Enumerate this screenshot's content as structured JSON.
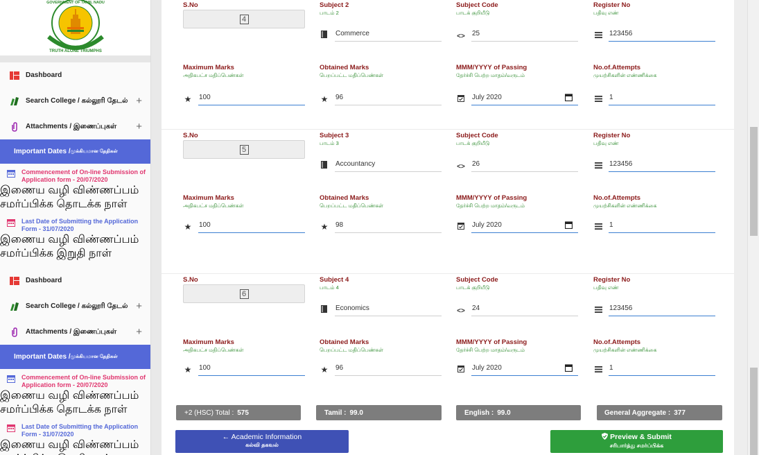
{
  "logo": {
    "alt_text_lines": [
      "GOVERNMENT OF TAMIL NADU",
      "TRUTH ALONE TRIUMPHS"
    ]
  },
  "sidebar": {
    "blocks": [
      {
        "dashboard": "Dashboard",
        "search": {
          "en": "Search College /",
          "ta": "கல்லூரி தேடல்"
        },
        "attachments": {
          "en": "Attachments /",
          "ta": "இணைப்புகள்"
        },
        "important": {
          "en": "Important Dates /",
          "ta": "முக்கியமான தேதிகள்"
        },
        "dates": [
          {
            "text": "Commencement of On-line Submission of Application form - 20/07/2020",
            "sub": "இணைய வழி விண்ணப்பம் சமர்ப்பிக்க தொடக்க நாள்",
            "color": "#e0366f"
          },
          {
            "text": "Last Date of Submitting the Application Form - 31/07/2020",
            "sub": "இணைய வழி விண்ணப்பம் சமர்ப்பிக்க இறுதி நாள்",
            "color": "#5468d8"
          }
        ]
      },
      {
        "dashboard": "Dashboard",
        "search": {
          "en": "Search College /",
          "ta": "கல்லூரி தேடல்"
        },
        "attachments": {
          "en": "Attachments /",
          "ta": "இணைப்புகள்"
        },
        "important": {
          "en": "Important Dates /",
          "ta": "முக்கியமான தேதிகள்"
        },
        "dates": [
          {
            "text": "Commencement of On-line Submission of Application form - 20/07/2020",
            "sub": "இணைய வழி விண்ணப்பம் சமர்ப்பிக்க தொடக்க நாள்",
            "color": "#e0366f"
          },
          {
            "text": "Last Date of Submitting the Application Form - 31/07/2020",
            "sub": "இணைய வழி விண்ணப்பம் சமர்ப்பிக்க இறுதி நாள்",
            "color": "#5468d8"
          }
        ]
      }
    ],
    "plus": "+"
  },
  "labels": {
    "sno": "S.No",
    "subject_code_en": "Subject Code",
    "subject_code_ta": "பாடக் குறியீடு",
    "register_en": "Register No",
    "register_ta": "பதிவு எண்",
    "max_en": "Maximum Marks",
    "max_ta": "அதிகபட்ச மதிப்பெண்கள்",
    "obt_en": "Obtained Marks",
    "obt_ta": "பெறப்பட்ட மதிப்பெண்கள்",
    "pass_en": "MMM/YYYY of Passing",
    "pass_ta": "தேர்ச்சி பெற்ற மாதம்/வருடம்",
    "att_en": "No.of.Attempts",
    "att_ta": "முயற்சிகளின் எண்ணிக்கை"
  },
  "subjects": [
    {
      "sno": "4",
      "subject_en": "Subject 2",
      "subject_ta": "பாடம் 2",
      "name": "Commerce",
      "code": "25",
      "register": "123456",
      "max": "100",
      "obtained": "96",
      "passing": "July 2020",
      "attempts": "1"
    },
    {
      "sno": "5",
      "subject_en": "Subject 3",
      "subject_ta": "பாடம் 3",
      "name": "Accountancy",
      "code": "26",
      "register": "123456",
      "max": "100",
      "obtained": "98",
      "passing": "July 2020",
      "attempts": "1"
    },
    {
      "sno": "6",
      "subject_en": "Subject 4",
      "subject_ta": "பாடம் 4",
      "name": "Economics",
      "code": "24",
      "register": "123456",
      "max": "100",
      "obtained": "96",
      "passing": "July 2020",
      "attempts": "1"
    }
  ],
  "totals": {
    "hsc_label": "+2 (HSC) Total :",
    "hsc_value": "575",
    "tamil_label": "Tamil :",
    "tamil_value": "99.0",
    "english_label": "English :",
    "english_value": "99.0",
    "agg_label": "General Aggregate :",
    "agg_value": "377"
  },
  "buttons": {
    "back_label": "← Academic Information",
    "back_sub": "கல்வி தகவல்",
    "submit_label": "Preview & Submit",
    "submit_sub": "சரிபார்த்து சமர்ப்பிக்க"
  },
  "icons": {
    "book": "book-icon",
    "code": "code-icon",
    "list": "list-icon",
    "star": "star-icon",
    "calendar": "calendar-icon"
  },
  "colors": {
    "label_red": "#8b1a1a",
    "tamil_green": "#2c8a2c",
    "accent_blue": "#5468d8",
    "submit_green": "#2e9e3c",
    "back_blue": "#3f51b5"
  }
}
